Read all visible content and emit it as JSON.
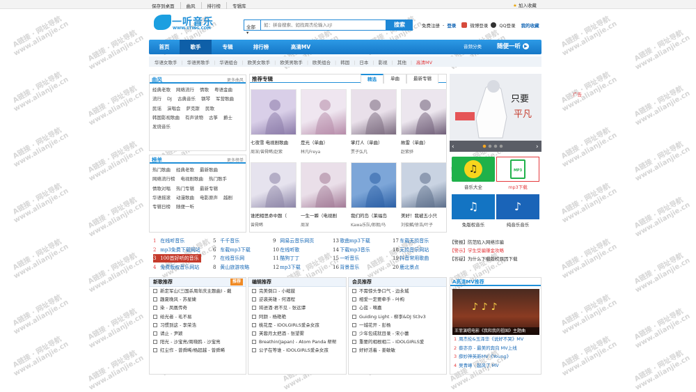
{
  "topbar": {
    "links": [
      "保存到桌面",
      "曲风",
      "排行榜",
      "专辑库"
    ],
    "favorite": "加入收藏"
  },
  "logo": {
    "name": "一听音乐",
    "url": "WWW.1TING.COM"
  },
  "search": {
    "scope": "全部",
    "placeholder": "如：拼音搜索、如找周杰伦输入zjl",
    "button": "搜索"
  },
  "login": {
    "register": "免费注册",
    "login": "登录",
    "weibo": "微博登录",
    "qq": "QQ登录",
    "mine": "我的收藏"
  },
  "nav": {
    "items": [
      "首页",
      "歌手",
      "专辑",
      "排行榜",
      "高清MV"
    ],
    "category": "音频分类",
    "one": "随便一听"
  },
  "subnav": [
    "华语女歌手",
    "华语男歌手",
    "华语组合",
    "欧美女歌手",
    "欧美男歌手",
    "欧美组合",
    "韩国",
    "日本",
    "影视",
    "其他",
    "高清MV"
  ],
  "quFeng": {
    "title": "曲风",
    "more": "更多曲风",
    "tags": [
      "经典老歌",
      "网络流行",
      "情歌",
      "粤语金曲",
      "流行",
      "DJ",
      "古典音乐",
      "钢琴",
      "军营歌曲",
      "民谣",
      "演唱会",
      "萨克斯",
      "民歌",
      "韩国影视歌曲",
      "有声读物",
      "古筝",
      "爵士",
      "发烧音乐"
    ]
  },
  "bangDan": {
    "title": "榜单",
    "more": "更多榜单",
    "tags": [
      "热门歌曲",
      "经典老歌",
      "最新歌曲",
      "网络流行榜",
      "电视剧歌曲",
      "热门歌手",
      "情歌对唱",
      "热门专辑",
      "最新专辑",
      "华语摇滚",
      "动漫歌曲",
      "电影原声",
      "越剧",
      "专辑日榜",
      "随便一听"
    ]
  },
  "albums": {
    "title": "推荐专辑",
    "tabs": [
      "精选",
      "单曲",
      "最新专辑"
    ],
    "items": [
      {
        "title": "七夜雪 电视剧歌曲",
        "artist": "周深/曾舜晞/赵紫"
      },
      {
        "title": "是光（单曲）",
        "artist": "林凡Freya"
      },
      {
        "title": "掌灯人（单曲）",
        "artist": "贾子弘凡"
      },
      {
        "title": "故雷（单曲）",
        "artist": "赵紫骅"
      },
      {
        "title": "谁把相思命中题（",
        "artist": "曾舜晞"
      },
      {
        "title": "一生一瞬（电视剧",
        "artist": "周深"
      },
      {
        "title": "我们的岛（莱福岛",
        "artist": "Kawa乐队/郎朗/马"
      },
      {
        "title": "美好！我被五小只",
        "artist": "刘俊麟/徐浩/叶子"
      }
    ]
  },
  "side": {
    "banner_text": "只要平凡",
    "apps": [
      "音乐大全",
      "mp3下载",
      "免版权音乐",
      "纯音乐音乐"
    ],
    "ad": "广告"
  },
  "ranks": [
    {
      "n": "1",
      "t": "在线听音乐"
    },
    {
      "n": "2",
      "t": "mp3免费下载网站"
    },
    {
      "n": "3",
      "t": "100首好听的音乐"
    },
    {
      "n": "4",
      "t": "免费版权音乐网站"
    },
    {
      "n": "5",
      "t": "千千音乐"
    },
    {
      "n": "6",
      "t": "车载mp3下载"
    },
    {
      "n": "7",
      "t": "在线音乐网"
    },
    {
      "n": "8",
      "t": "黄山旅游攻略"
    },
    {
      "n": "9",
      "t": "网易云音乐网页"
    },
    {
      "n": "10",
      "t": "在线听歌"
    },
    {
      "n": "11",
      "t": "酷狗丁丁"
    },
    {
      "n": "12",
      "t": "mp3下载"
    },
    {
      "n": "13",
      "t": "歌曲mp3下载"
    },
    {
      "n": "14",
      "t": "下载mp3音乐"
    },
    {
      "n": "15",
      "t": "一听音乐"
    },
    {
      "n": "16",
      "t": "背景音乐"
    },
    {
      "n": "17",
      "t": "车载无损音乐"
    },
    {
      "n": "18",
      "t": "无损音乐网站"
    },
    {
      "n": "19",
      "t": "抖音常用歌曲"
    },
    {
      "n": "20",
      "t": "鹿北景点"
    }
  ],
  "news": [
    {
      "tag": "【警报】",
      "t": "防范陷入网络诈骗"
    },
    {
      "tag": "【警示】",
      "t": "学生受骗赚金攻略"
    },
    {
      "tag": "【答疑】",
      "t": "为什么下载版权原因下载"
    }
  ],
  "newSongs": {
    "title": "新歌推荐",
    "badge": "推荐",
    "rows": [
      "新定军山(三国杀周年庆主题曲) - 戴",
      "趣夏晚风 - 苏星婕",
      "染 - 凤凰传奇",
      "给光者 - 毛不易",
      "习惯到这 - 李荣浩",
      "请止 - 尹颖",
      "阳光 - 沙宝亮/周晓鸥 - 沙宝亮",
      "红尘作 - 曾舜晞/杨超越 - 曾舜晞"
    ]
  },
  "editorPick": {
    "title": "编辑推荐",
    "rows": [
      "完美倒口 - 小缩鼓",
      "逆袭英雄 - 何酒程",
      "将进酒·君不见 - 张远谭",
      "阿颜 - 杨艳艳",
      "桃花是 - IDOLGIRLS爱朵女孩",
      "芙蓉月太把酒 - 张望雾",
      "Breathin(Japan) - Atom Panda 帮帮",
      "公子在等谁 - IDOLGIRLS爱朵女孩"
    ]
  },
  "memberPick": {
    "title": "会员推荐",
    "rows": [
      "不需惊头争口气 - 边永城",
      "相爱一定要牵手 - 叶枸",
      "心蓝 - 嘀嘉",
      "Guiding Light - 柳李&DJ St3v3",
      "一城花开 - 彭杨",
      "少年包成就目录 - 宋小蕾",
      "重要的相根相二 - IDOLGIRLS爱",
      "好好活着 - 姜敏敏"
    ]
  },
  "mvBox": {
    "title": "A高清MV推荐",
    "caption": "王菲演唱电影《我和我的祖国》主题曲",
    "items": [
      {
        "n": "1",
        "t": "周杰伦&玉泽华《说好不哭》MV"
      },
      {
        "n": "2",
        "t": "蔡亦亦 - 最美的奔向 MV上线"
      },
      {
        "n": "3",
        "t": "薛妙神英新MV《Young》"
      },
      {
        "n": "4",
        "t": "吴青峰 - 起风了 MV"
      }
    ]
  },
  "watermark": [
    "A链接 · 网址导航",
    "www.alianjie.cn"
  ],
  "colors": {
    "brand": "#1f8fd8",
    "nav": "#1577c7",
    "accent": "#e4393c"
  }
}
